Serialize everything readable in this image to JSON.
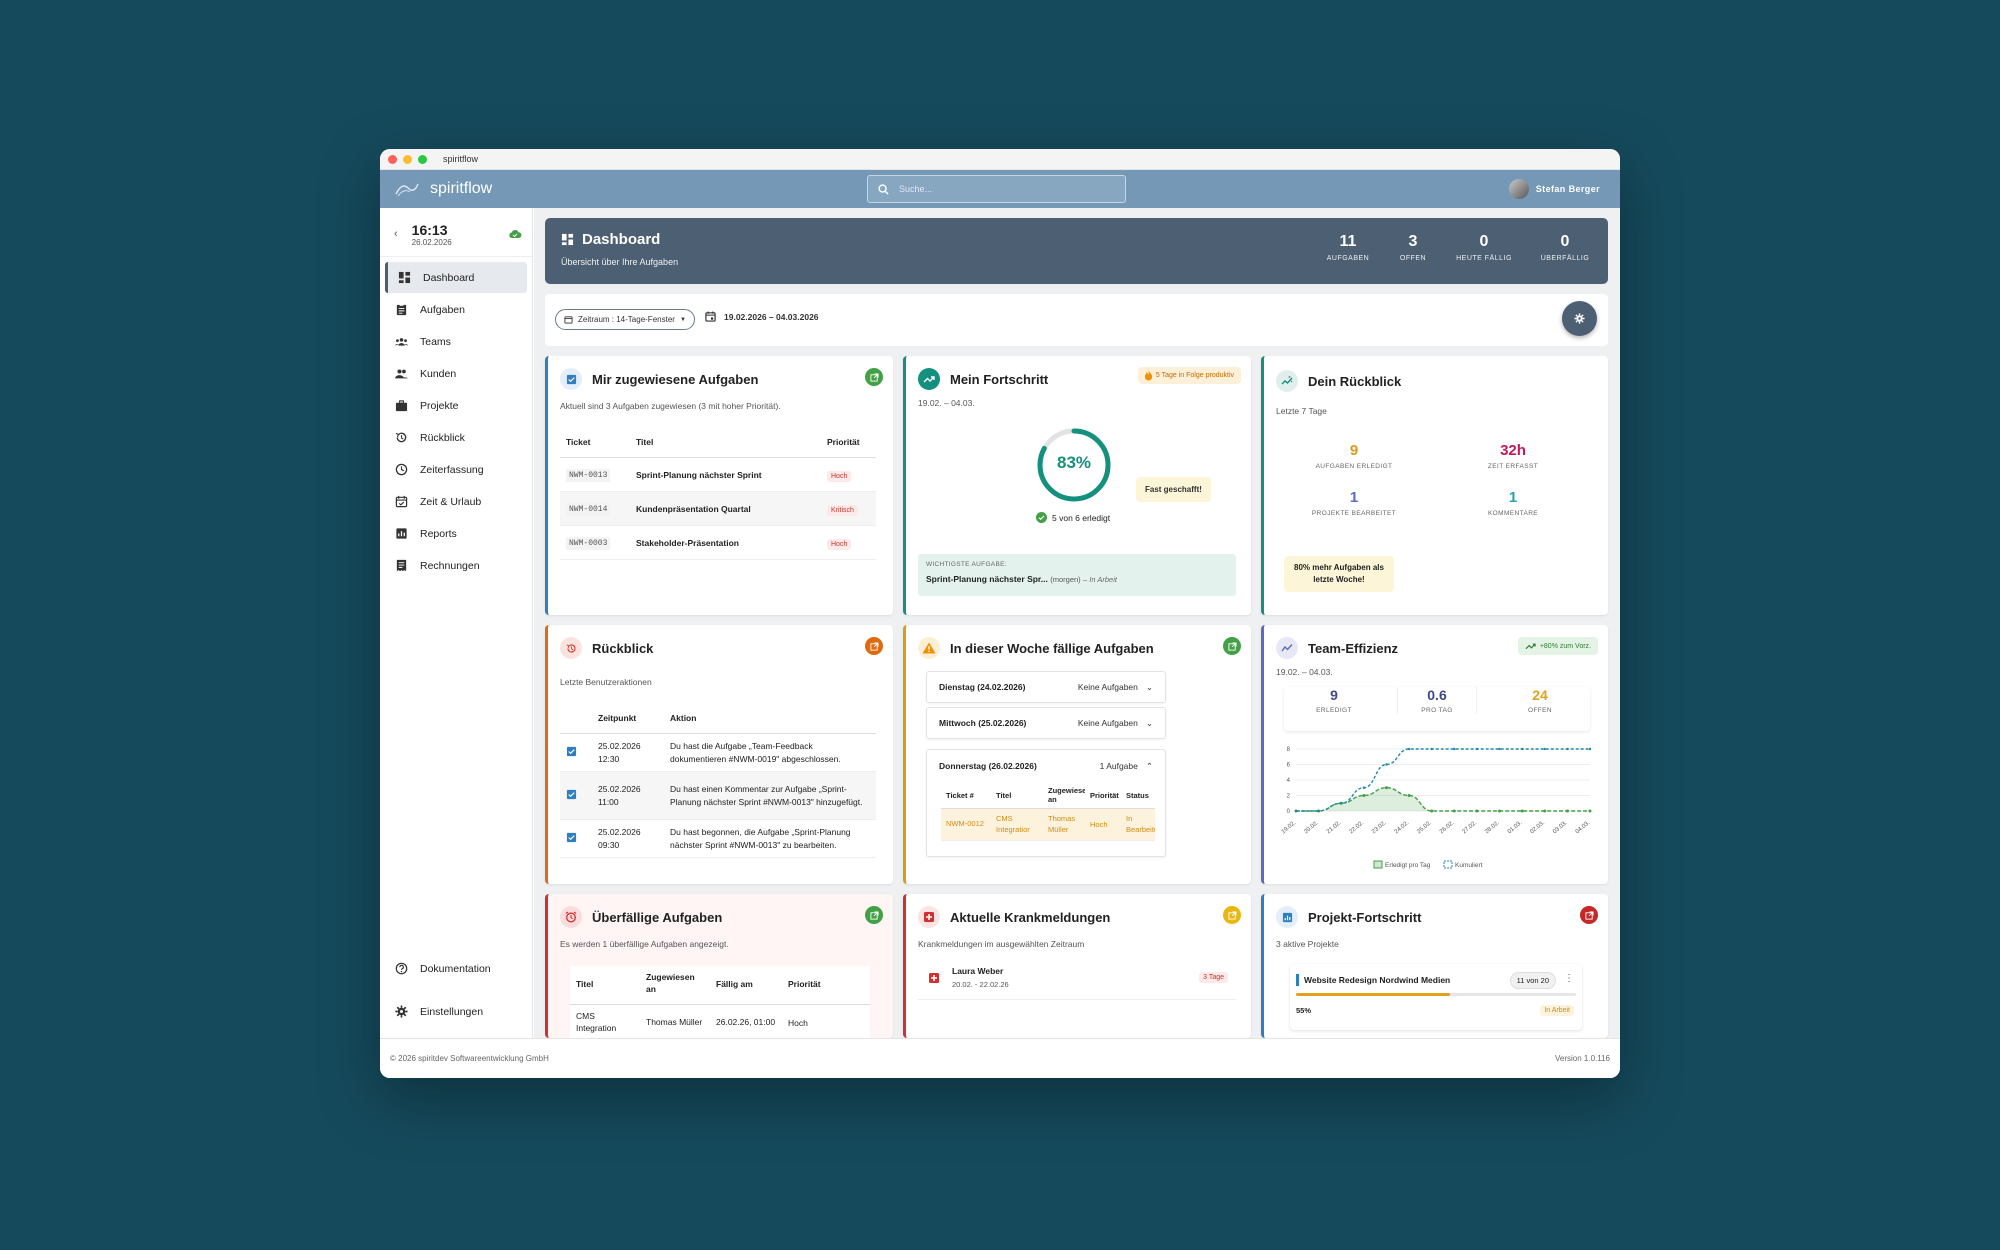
{
  "window": {
    "title": "spiritflow"
  },
  "topbar": {
    "brand": "spiritflow",
    "search_placeholder": "Suche...",
    "user_name": "Stefan Berger"
  },
  "sidebar": {
    "time": "16:13",
    "date": "26.02.2026",
    "items": [
      {
        "label": "Dashboard",
        "icon": "dashboard-icon"
      },
      {
        "label": "Aufgaben",
        "icon": "clipboard-icon"
      },
      {
        "label": "Teams",
        "icon": "group-icon"
      },
      {
        "label": "Kunden",
        "icon": "people-icon"
      },
      {
        "label": "Projekte",
        "icon": "briefcase-icon"
      },
      {
        "label": "Rückblick",
        "icon": "history-icon"
      },
      {
        "label": "Zeiterfassung",
        "icon": "clock-icon"
      },
      {
        "label": "Zeit & Urlaub",
        "icon": "calendar-check-icon"
      },
      {
        "label": "Reports",
        "icon": "chart-icon"
      },
      {
        "label": "Rechnungen",
        "icon": "receipt-icon"
      }
    ],
    "bottom": [
      {
        "label": "Dokumentation",
        "icon": "help-icon"
      },
      {
        "label": "Einstellungen",
        "icon": "gear-icon"
      }
    ]
  },
  "header": {
    "title": "Dashboard",
    "subtitle": "Übersicht über Ihre Aufgaben",
    "stats": [
      {
        "value": "11",
        "label": "AUFGABEN"
      },
      {
        "value": "3",
        "label": "OFFEN"
      },
      {
        "value": "0",
        "label": "HEUTE FÄLLIG"
      },
      {
        "value": "0",
        "label": "ÜBERFÄLLIG"
      }
    ]
  },
  "filter": {
    "chip": "Zeitraum : 14-Tage-Fenster",
    "range": "19.02.2026 – 04.03.2026"
  },
  "assigned": {
    "title": "Mir zugewiesene Aufgaben",
    "subtitle": "Aktuell sind 3 Aufgaben zugewiesen (3 mit hoher Priorität).",
    "headers": [
      "Ticket",
      "Titel",
      "Priorität"
    ],
    "rows": [
      {
        "ticket": "NWM-0013",
        "title": "Sprint-Planung nächster Sprint",
        "prio": "Hoch"
      },
      {
        "ticket": "NWM-0014",
        "title": "Kundenpräsentation Quartal",
        "prio": "Kritisch"
      },
      {
        "ticket": "NWM-0003",
        "title": "Stakeholder-Präsentation",
        "prio": "Hoch"
      }
    ]
  },
  "progress": {
    "title": "Mein Fortschritt",
    "badge": "5 Tage in Folge produktiv",
    "range": "19.02. – 04.03.",
    "percent_label": "83%",
    "fraction": 0.83,
    "done": "5 von 6 erledigt",
    "bubble": "Fast geschafft!",
    "important_label": "WICHTIGSTE AUFGABE:",
    "important_task": "Sprint-Planung nächster Spr...",
    "important_due": "(morgen)",
    "important_status": "– In Arbeit"
  },
  "review_summary": {
    "title": "Dein Rückblick",
    "subtitle": "Letzte 7 Tage",
    "stats": [
      {
        "value": "9",
        "label": "AUFGABEN ERLEDIGT",
        "color": "#d99a1e"
      },
      {
        "value": "32h",
        "label": "ZEIT ERFASST",
        "color": "#c2185b"
      },
      {
        "value": "1",
        "label": "PROJEKTE BEARBEITET",
        "color": "#5c6bc0"
      },
      {
        "value": "1",
        "label": "KOMMENTARE",
        "color": "#26a0b5"
      }
    ],
    "note": "80% mehr Aufgaben als letzte Woche!"
  },
  "activity": {
    "title": "Rückblick",
    "subtitle": "Letzte Benutzeraktionen",
    "headers": [
      "Zeitpunkt",
      "Aktion"
    ],
    "rows": [
      {
        "time": "25.02.2026 12:30",
        "action": "Du hast die Aufgabe „Team-Feedback dokumentieren #NWM-0019\" abgeschlossen."
      },
      {
        "time": "25.02.2026 11:00",
        "action": "Du hast einen Kommentar zur Aufgabe „Sprint-Planung nächster Sprint #NWM-0013\" hinzugefügt."
      },
      {
        "time": "25.02.2026 09:30",
        "action": "Du hast begonnen, die Aufgabe „Sprint-Planung nächster Sprint #NWM-0013\" zu bearbeiten."
      }
    ]
  },
  "week": {
    "title": "In dieser Woche fällige Aufgaben",
    "days": [
      {
        "label": "Dienstag (24.02.2026)",
        "value": "Keine Aufgaben"
      },
      {
        "label": "Mittwoch (25.02.2026)",
        "value": "Keine Aufgaben"
      },
      {
        "label": "Donnerstag (26.02.2026)",
        "value": "1 Aufgabe"
      }
    ],
    "headers": [
      "Ticket #",
      "Titel",
      "Zugewiese an",
      "Priorität",
      "Status"
    ],
    "row": {
      "ticket": "NWM-0012",
      "title": "CMS Integratior",
      "assignee": "Thomas Müller",
      "prio": "Hoch",
      "status": "In Bearbeitung"
    }
  },
  "efficiency": {
    "title": "Team-Effizienz",
    "badge": "+80% zum Vorz.",
    "range": "19.02. – 04.03.",
    "stats": [
      {
        "value": "9",
        "label": "ERLEDIGT",
        "color": "#3f4a8a"
      },
      {
        "value": "0.6",
        "label": "PRO TAG",
        "color": "#3f4a8a"
      },
      {
        "value": "24",
        "label": "OFFEN",
        "color": "#e0a21c"
      }
    ],
    "legend": [
      "Erledigt pro Tag",
      "Kumuliert"
    ]
  },
  "chart_data": {
    "type": "line",
    "x": [
      "19.02.",
      "20.02.",
      "21.02.",
      "22.02.",
      "23.02.",
      "24.02.",
      "25.02.",
      "26.02.",
      "27.02.",
      "28.02.",
      "01.03.",
      "02.03.",
      "03.03.",
      "04.03."
    ],
    "y_ticks": [
      "0",
      "2",
      "4",
      "6",
      "8"
    ],
    "ylim": [
      0,
      8
    ],
    "series": [
      {
        "name": "Erledigt pro Tag",
        "values": [
          0,
          0,
          1,
          2,
          3,
          2,
          0,
          0,
          0,
          0,
          0,
          0,
          0,
          0
        ],
        "color": "#43a047"
      },
      {
        "name": "Kumuliert",
        "values": [
          0,
          0,
          1,
          3,
          6,
          8,
          8,
          8,
          8,
          8,
          8,
          8,
          8,
          8
        ],
        "color": "#1e88a8"
      }
    ]
  },
  "overdue": {
    "title": "Überfällige Aufgaben",
    "subtitle": "Es werden 1 überfällige Aufgaben angezeigt.",
    "headers": [
      "Titel",
      "Zugewiesen an",
      "Fällig am",
      "Priorität"
    ],
    "row": {
      "title": "CMS Integration",
      "assignee": "Thomas Müller",
      "due": "26.02.26, 01:00",
      "prio": "Hoch"
    }
  },
  "sick": {
    "title": "Aktuelle Krankmeldungen",
    "subtitle": "Krankmeldungen im ausgewählten Zeitraum",
    "name": "Laura Weber",
    "range": "20.02. - 22.02.26",
    "badge": "3 Tage"
  },
  "projects": {
    "title": "Projekt-Fortschritt",
    "subtitle": "3 aktive Projekte",
    "name": "Website Redesign Nordwind Medien",
    "count": "11 von 20",
    "percent_label": "55%",
    "fraction": 0.55,
    "status": "In Arbeit"
  },
  "footer": {
    "left": "© 2026 spiritdev Softwareentwicklung GmbH",
    "right": "Version 1.0.116"
  }
}
